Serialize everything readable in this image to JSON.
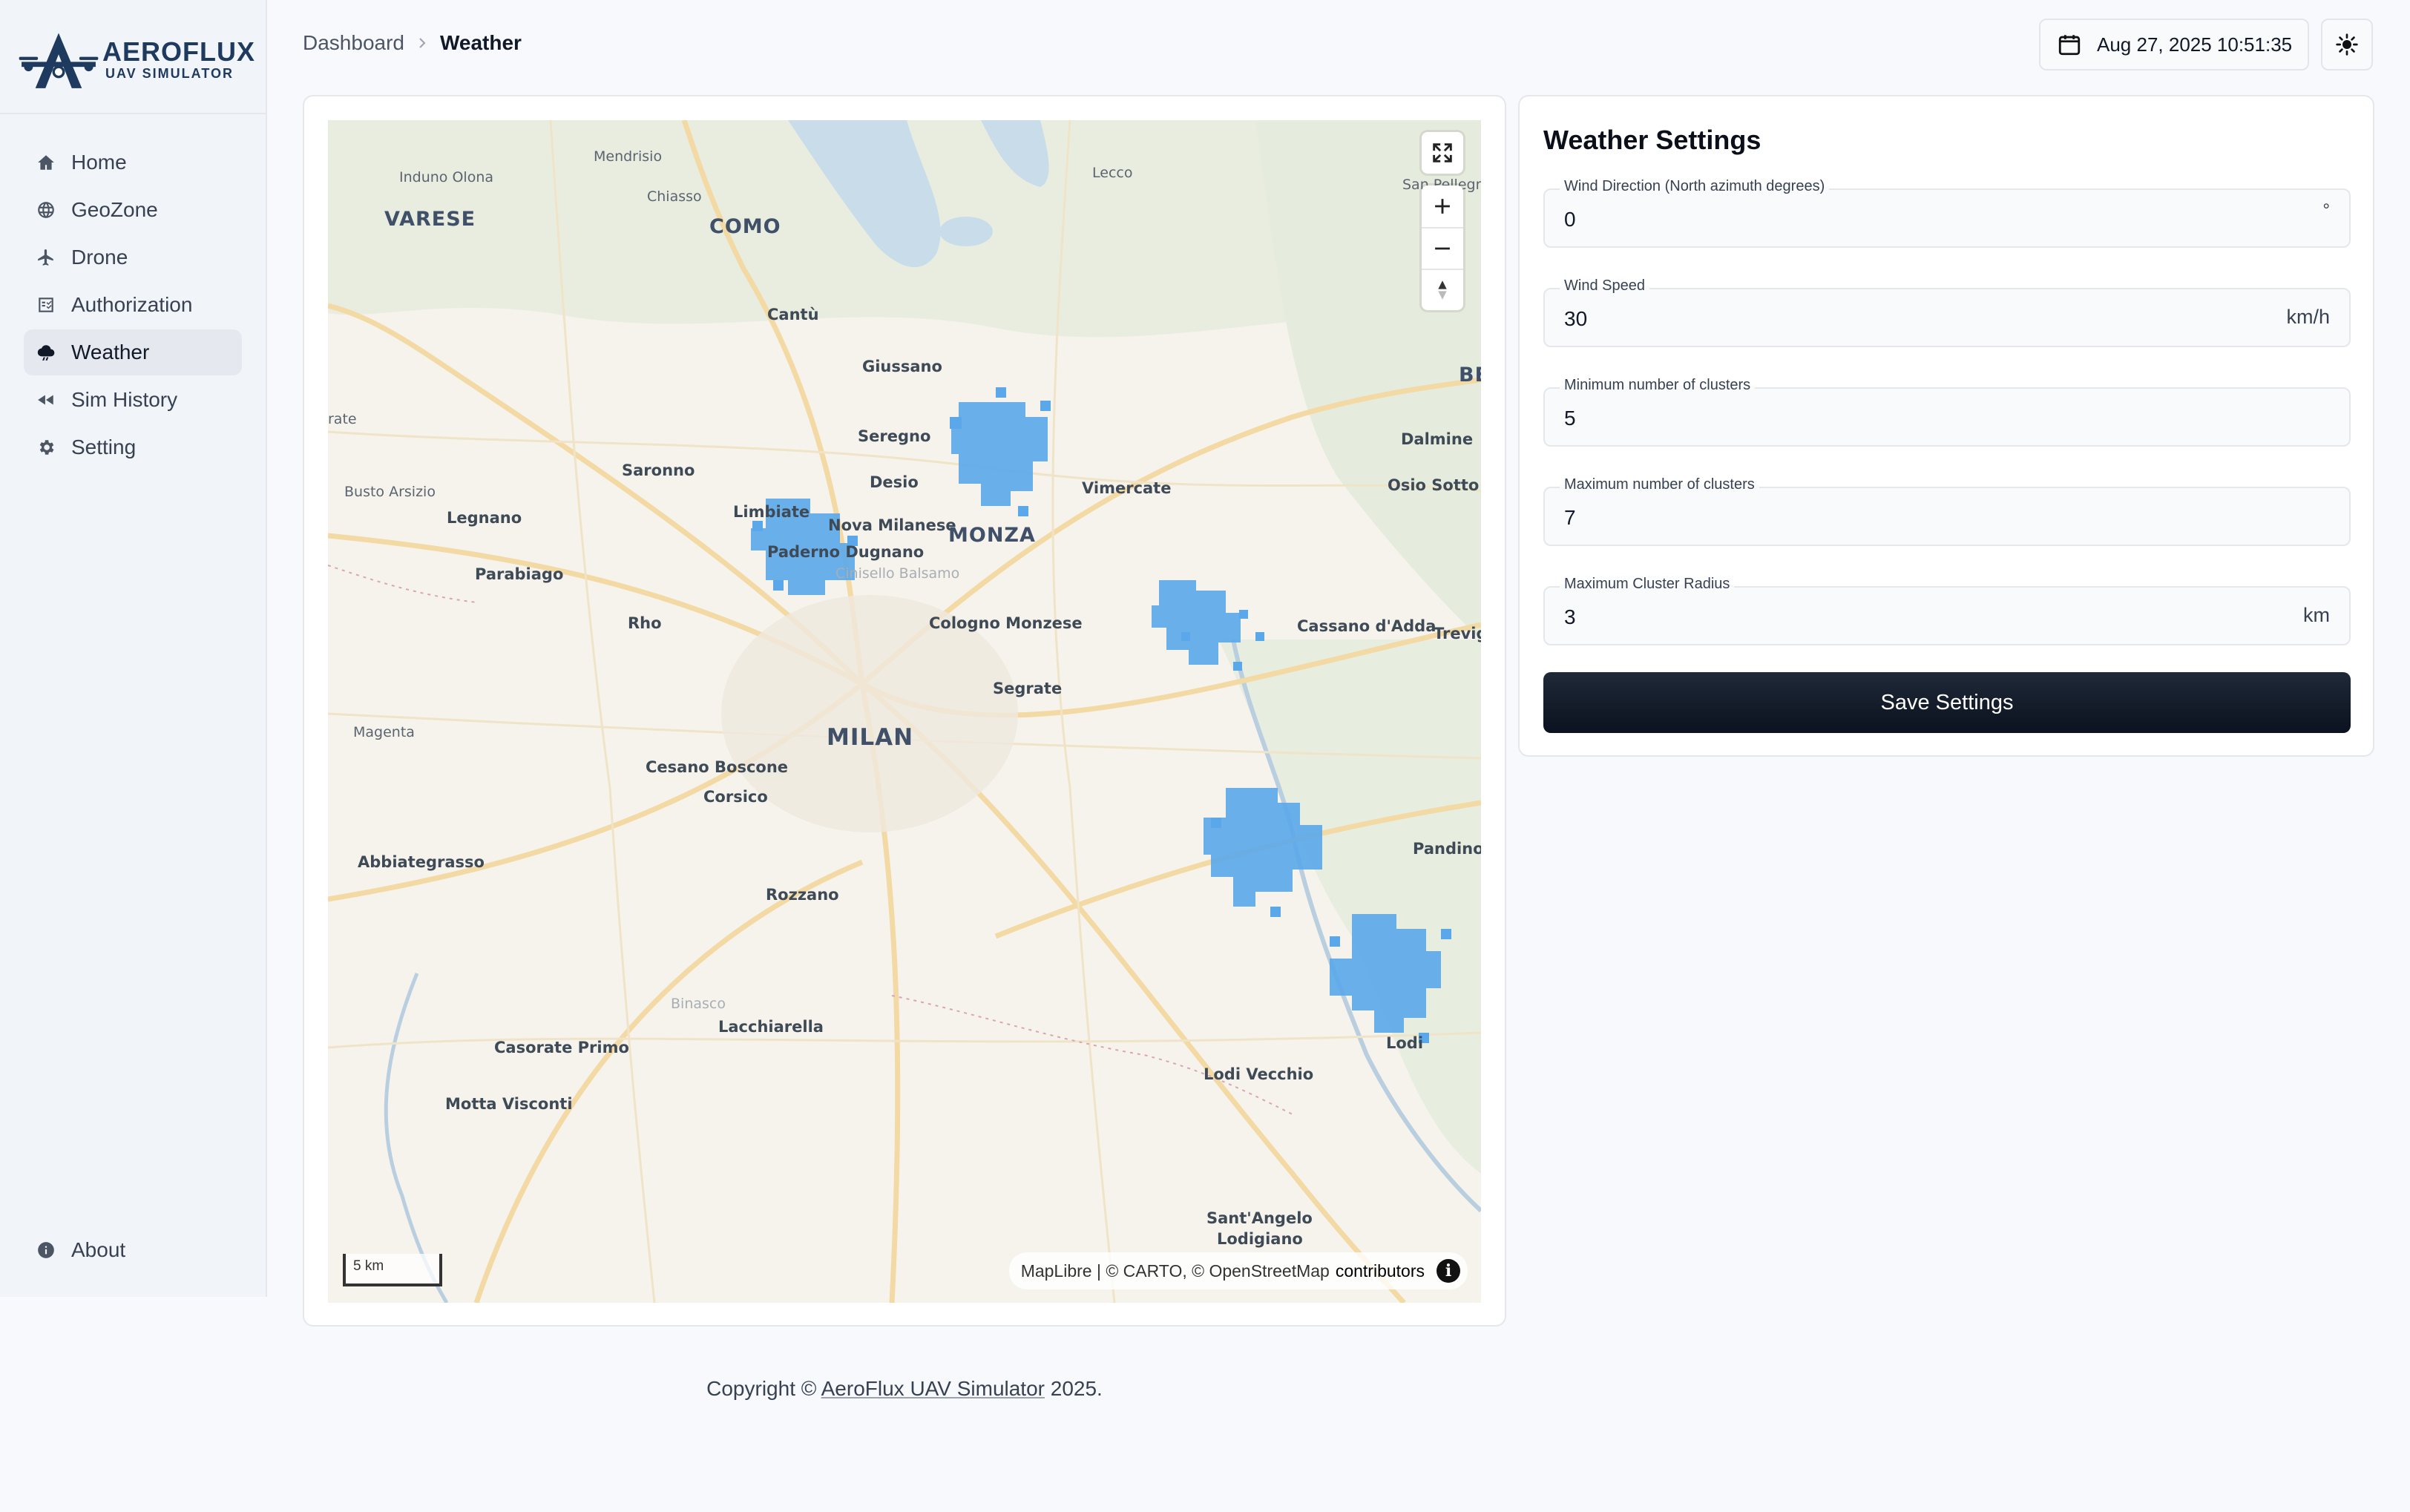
{
  "brand": {
    "title": "AEROFLUX",
    "subtitle": "UAV SIMULATOR"
  },
  "sidebar": {
    "items": [
      {
        "label": "Home",
        "icon": "home-icon"
      },
      {
        "label": "GeoZone",
        "icon": "globe-icon"
      },
      {
        "label": "Drone",
        "icon": "plane-icon"
      },
      {
        "label": "Authorization",
        "icon": "checklist-icon"
      },
      {
        "label": "Weather",
        "icon": "cloud-rain-icon",
        "active": true
      },
      {
        "label": "Sim History",
        "icon": "rewind-icon"
      },
      {
        "label": "Setting",
        "icon": "gear-icon"
      }
    ],
    "about": {
      "label": "About",
      "icon": "info-icon"
    }
  },
  "breadcrumb": {
    "parent": "Dashboard",
    "current": "Weather"
  },
  "header": {
    "datetime": "Aug 27, 2025 10:51:35",
    "theme_icon": "sun-icon"
  },
  "map": {
    "places": {
      "induno_olona": "Induno Olona",
      "mendrisio": "Mendrisio",
      "chiasso": "Chiasso",
      "varese": "VARESE",
      "como": "COMO",
      "lecco": "Lecco",
      "san_pellegrino": "San Pellegr",
      "cantu": "Cantù",
      "giussano": "Giussano",
      "be": "BE",
      "rate": "rate",
      "seregno": "Seregno",
      "saronno": "Saronno",
      "dalmine": "Dalmine",
      "busto_arsizio": "Busto Arsizio",
      "desio": "Desio",
      "vimercate": "Vimercate",
      "osio_sotto": "Osio Sotto",
      "legnano": "Legnano",
      "limbiate": "Limbiate",
      "nova_milanese": "Nova Milanese",
      "monza": "MONZA",
      "paderno_dugnano": "Paderno Dugnano",
      "cinisello_balsamo": "Cinisello Balsamo",
      "parabiago": "Parabiago",
      "rho": "Rho",
      "cologno_monzese": "Cologno Monzese",
      "cassano_adda": "Cassano d'Adda",
      "treviglio": "Trevigl",
      "segrate": "Segrate",
      "magenta": "Magenta",
      "milan": "MILAN",
      "cesano_boscone": "Cesano Boscone",
      "corsico": "Corsico",
      "pandino": "Pandino",
      "abbiategrasso": "Abbiategrasso",
      "rozzano": "Rozzano",
      "binasco": "Binasco",
      "lacchiarella": "Lacchiarella",
      "lodi": "Lodi",
      "casorate_primo": "Casorate Primo",
      "lodi_vecchio": "Lodi Vecchio",
      "motta_visconti": "Motta Visconti",
      "santangelo": "Sant'Angelo",
      "lodigiano": "Lodigiano"
    },
    "scale": "5 km",
    "attribution": "MapLibre | © CARTO, © OpenStreetMap",
    "contributors": "contributors",
    "cluster_color": "#5aa7ea"
  },
  "settings": {
    "title": "Weather Settings",
    "fields": [
      {
        "label": "Wind Direction (North azimuth degrees)",
        "value": "0",
        "unit": "°"
      },
      {
        "label": "Wind Speed",
        "value": "30",
        "unit": "km/h"
      },
      {
        "label": "Minimum number of clusters",
        "value": "5",
        "unit": ""
      },
      {
        "label": "Maximum number of clusters",
        "value": "7",
        "unit": ""
      },
      {
        "label": "Maximum Cluster Radius",
        "value": "3",
        "unit": "km"
      }
    ],
    "save_label": "Save Settings"
  },
  "footer": {
    "prefix": "Copyright © ",
    "link": "AeroFlux UAV Simulator",
    "suffix": " 2025."
  }
}
